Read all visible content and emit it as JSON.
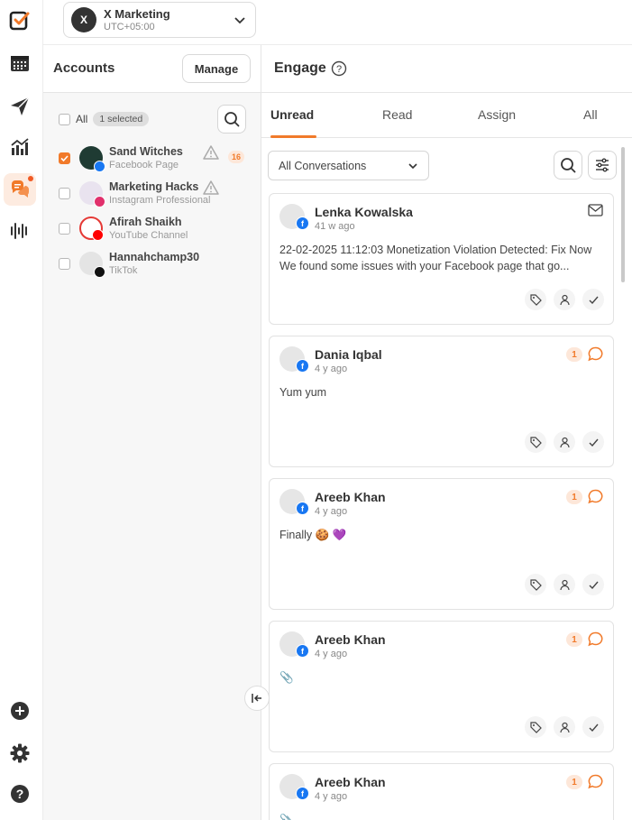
{
  "workspace": {
    "initial": "X",
    "name": "X Marketing",
    "timezone": "UTC+05:00"
  },
  "rail": {
    "items": [
      "logo",
      "calendar",
      "publish",
      "analytics",
      "engage",
      "listening"
    ],
    "bottom": [
      "add",
      "settings",
      "help"
    ],
    "accent": "#f17a2a"
  },
  "accounts": {
    "title": "Accounts",
    "manage_label": "Manage",
    "all_label": "All",
    "selected_badge": "1 selected",
    "items": [
      {
        "name": "Sand Witches",
        "type": "Facebook Page",
        "checked": true,
        "warning": true,
        "count": "16"
      },
      {
        "name": "Marketing Hacks",
        "type": "Instagram Professional",
        "checked": false,
        "warning": true
      },
      {
        "name": "Afirah Shaikh",
        "type": "YouTube Channel",
        "checked": false
      },
      {
        "name": "Hannahchamp30",
        "type": "TikTok",
        "checked": false
      }
    ]
  },
  "engage": {
    "title": "Engage",
    "tabs": [
      "Unread",
      "Read",
      "Assign",
      "All"
    ],
    "active_tab": "Unread",
    "filter_value": "All Conversations",
    "conversations": [
      {
        "name": "Lenka Kowalska",
        "time": "41 w ago",
        "type": "message",
        "message": "22-02-2025 11:12:03 Monetization Violation Detected: Fix Now We found some issues with your Facebook page that go..."
      },
      {
        "name": "Dania Iqbal",
        "time": "4 y ago",
        "type": "comment",
        "count": "1",
        "message": "Yum yum"
      },
      {
        "name": "Areeb Khan",
        "time": "4 y ago",
        "type": "comment",
        "count": "1",
        "message": "Finally 🍪 💜"
      },
      {
        "name": "Areeb Khan",
        "time": "4 y ago",
        "type": "comment",
        "count": "1",
        "message": "📎"
      },
      {
        "name": "Areeb Khan",
        "time": "4 y ago",
        "type": "comment",
        "count": "1",
        "message": "📎"
      }
    ]
  }
}
